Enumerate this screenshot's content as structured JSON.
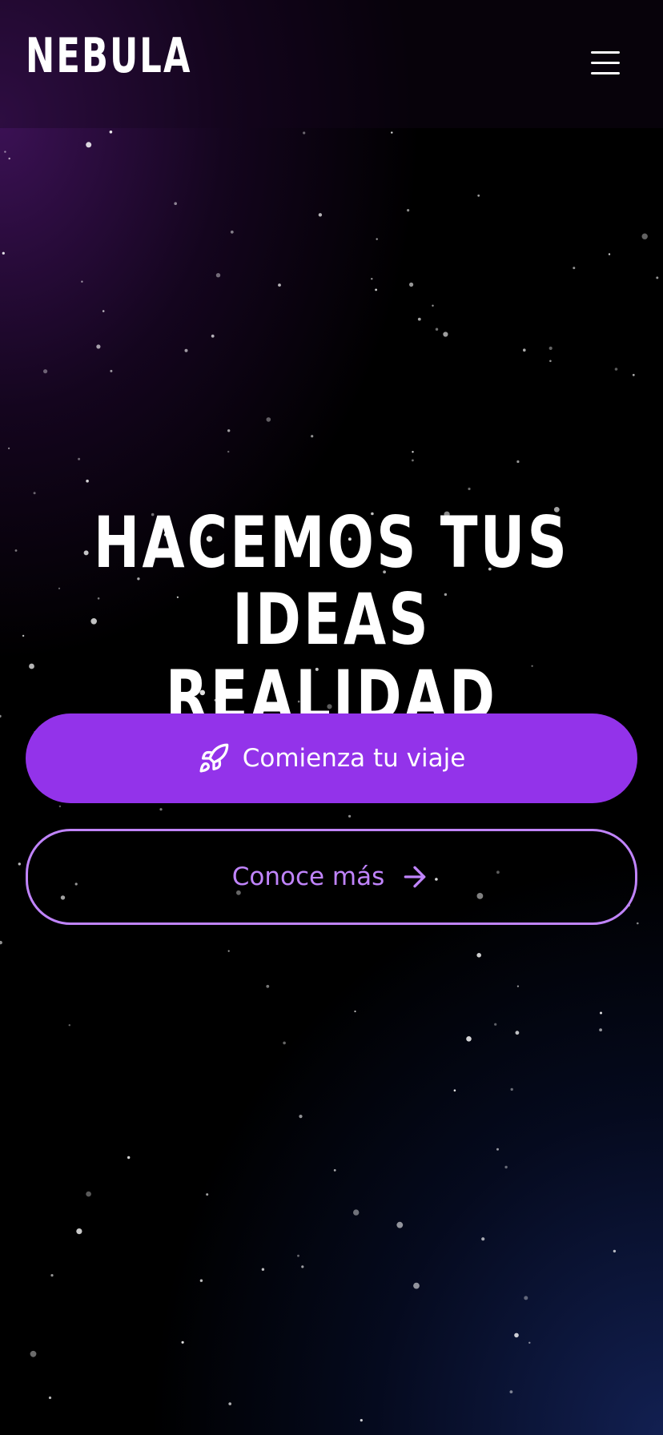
{
  "header": {
    "logo": "NEBULA",
    "menu_icon": "hamburger-menu-icon"
  },
  "hero": {
    "title_line1": "HACEMOS TUS IDEAS",
    "title_line2": "REALIDAD"
  },
  "buttons": {
    "primary": {
      "label": "Comienza tu viaje",
      "icon": "rocket-icon"
    },
    "secondary": {
      "label": "Conoce más",
      "icon": "arrow-right-icon"
    }
  },
  "colors": {
    "primary": "#9333ea",
    "secondary_outline": "#c084fc",
    "background": "#000000"
  }
}
